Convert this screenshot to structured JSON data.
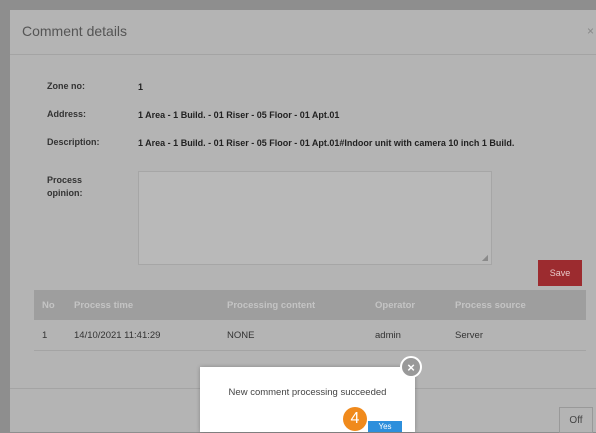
{
  "panel": {
    "title": "Comment details",
    "close_icon": "×"
  },
  "fields": [
    {
      "label": "Zone no:",
      "value": "1"
    },
    {
      "label": "Address:",
      "value": "1 Area - 1 Build. - 01 Riser - 05 Floor - 01 Apt.01"
    },
    {
      "label": "Description:",
      "value": "1 Area - 1 Build. - 01 Riser - 05 Floor - 01 Apt.01#Indoor unit with camera 10 inch 1 Build."
    },
    {
      "label": "Process",
      "label2": "opinion:",
      "value": ""
    }
  ],
  "save_label": "Save",
  "table": {
    "headers": [
      "No",
      "Process time",
      "Processing content",
      "Operator",
      "Process source"
    ],
    "rows": [
      [
        "1",
        "14/10/2021 11:41:29",
        "NONE",
        "admin",
        "Server"
      ]
    ]
  },
  "dialog": {
    "message": "New comment processing succeeded",
    "yes_label": "Yes",
    "close_icon": "×"
  },
  "step_badge": "4",
  "off_label": "Off",
  "colors": {
    "save_button": "#9c2b2f",
    "yes_button": "#2d8fdc",
    "badge": "#f08a1c"
  }
}
